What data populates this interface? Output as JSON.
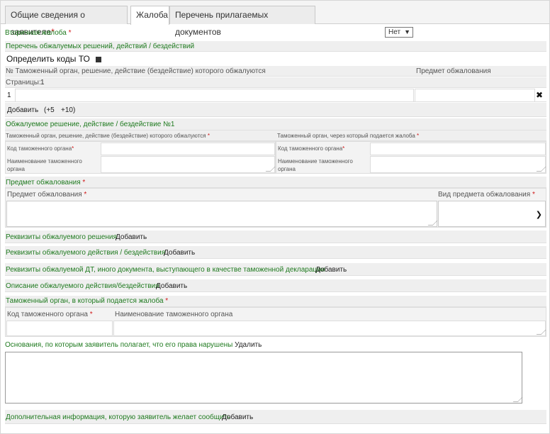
{
  "tabs": [
    {
      "label": "Общие сведения о заявителе",
      "required": "*"
    },
    {
      "label": "Жалоба"
    },
    {
      "label": "Перечень прилагаемых документов"
    }
  ],
  "secondary": {
    "label": "Вторичная жалоба",
    "req": "*",
    "value": "Нет"
  },
  "list_section": {
    "title": "Перечень обжалуемых решений, действий / бездействий",
    "determine_codes": "Определить коды ТО",
    "col_headers": [
      "№ Таможенный орган, решение, действие (бездействие) которого обжалуются",
      "Предмет обжалования"
    ],
    "pages_label": "Страницы:",
    "pages_value": "1",
    "row_number": "1",
    "delete_icon": "x-icon",
    "add_label": "Добавить",
    "add_plus5": "(+5",
    "add_plus10": "+10)"
  },
  "decision": {
    "title": "Обжалуемое решение, действие / бездействие №1",
    "left_head": "Таможенный орган, решение, действие (бездействие) которого обжалуются",
    "right_head": "Таможенный орган, через который подается жалоба",
    "req": "*",
    "code_label": "Код таможенного органа",
    "name_label_1": "Наименование таможенного",
    "name_label_2": "органа"
  },
  "subject": {
    "title": "Предмет обжалования",
    "req": "*",
    "subject_label": "Предмет обжалования",
    "type_label": "Вид предмета обжалования"
  },
  "requisites": [
    {
      "label": "Реквизиты обжалуемого решения",
      "action": "Добавить"
    },
    {
      "label": "Реквизиты обжалуемого действия / бездействия",
      "action": "Добавить"
    },
    {
      "label": "Реквизиты обжалуемой ДТ, иного документа, выступающего в качестве таможенной декларации",
      "action": "Добавить"
    },
    {
      "label": "Описание обжалуемого действия/бездействия",
      "action": "Добавить"
    }
  ],
  "target_organ": {
    "title": "Таможенный орган, в который подается жалоба",
    "req": "*",
    "code_label": "Код таможенного органа",
    "name_label": "Наименование таможенного органа"
  },
  "grounds": {
    "label": "Основания, по которым заявитель полагает, что его права нарушены",
    "action": "Удалить"
  },
  "additional": {
    "label": "Дополнительная информация, которую заявитель желает сообщить",
    "action": "Добавить"
  },
  "colors": {
    "green": "#1f7a1f",
    "required": "#d01818",
    "bar": "#efefef"
  }
}
